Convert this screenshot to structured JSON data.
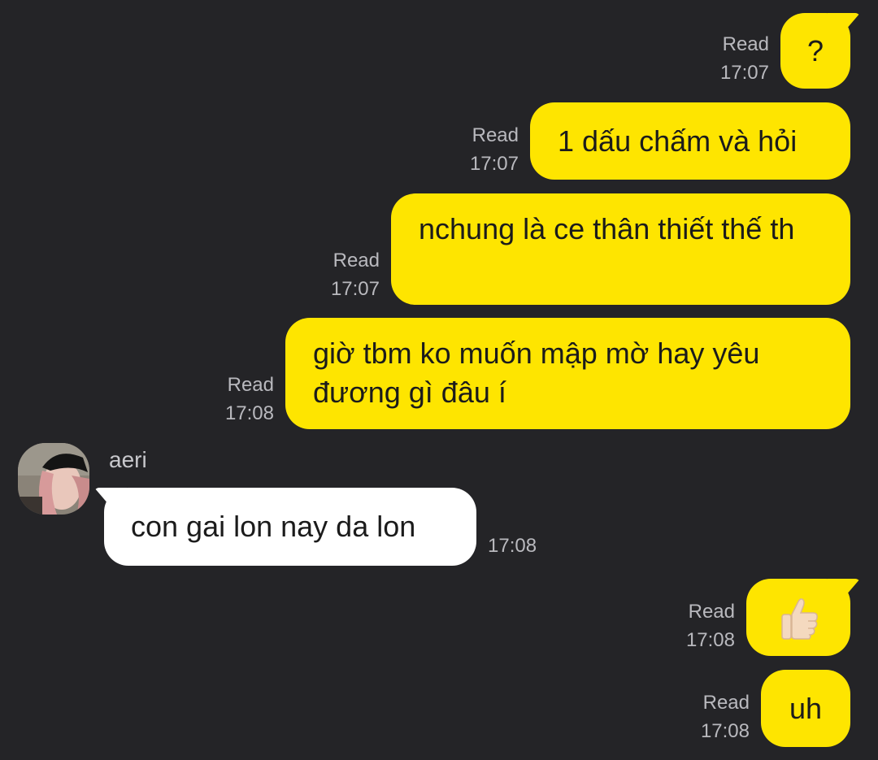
{
  "messages_out": [
    {
      "id": "m1",
      "text": "?",
      "status": "Read",
      "time": "17:07"
    },
    {
      "id": "m2",
      "text": "1 dấu chấm và hỏi",
      "status": "Read",
      "time": "17:07"
    },
    {
      "id": "m3",
      "text": "nchung là ce thân thiết thế th",
      "status": "Read",
      "time": "17:07"
    },
    {
      "id": "m4",
      "text": "giờ tbm ko muốn mập mờ hay yêu đương gì đâu í",
      "status": "Read",
      "time": "17:08"
    }
  ],
  "incoming": {
    "sender": "aeri",
    "text": "con gai lon nay da lon",
    "time": "17:08"
  },
  "messages_out_after": [
    {
      "id": "m6",
      "icon": "thumbs-up-icon",
      "status": "Read",
      "time": "17:08"
    },
    {
      "id": "m7",
      "text": "uh",
      "status": "Read",
      "time": "17:08"
    }
  ],
  "colors": {
    "background": "#242427",
    "outgoing_bubble": "#fee500",
    "incoming_bubble": "#ffffff",
    "meta_text": "#b9b9be"
  }
}
